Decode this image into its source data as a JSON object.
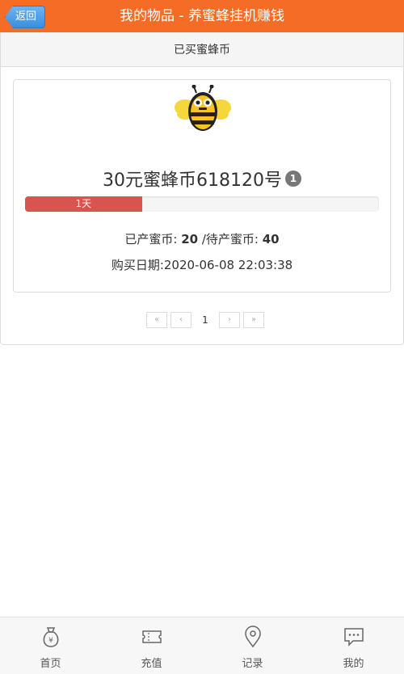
{
  "header": {
    "back_label": "返回",
    "title": "我的物品 - 养蜜蜂挂机赚钱"
  },
  "panel": {
    "heading": "已买蜜蜂币"
  },
  "item": {
    "name": "30元蜜蜂币618120号",
    "badge": "1",
    "progress": {
      "label": "1天",
      "percent": 33
    },
    "produced_label": "已产蜜币: ",
    "produced_value": "20",
    "pending_label": " /待产蜜币: ",
    "pending_value": "40",
    "buy_date": "购买日期:2020-06-08 22:03:38"
  },
  "pagination": {
    "first": "«",
    "prev": "‹",
    "current": "1",
    "next": "›",
    "last": "»"
  },
  "tabbar": {
    "items": [
      {
        "label": "首页",
        "icon": "money-bag-icon"
      },
      {
        "label": "充值",
        "icon": "ticket-icon"
      },
      {
        "label": "记录",
        "icon": "location-pin-icon"
      },
      {
        "label": "我的",
        "icon": "chat-bubble-icon"
      }
    ]
  },
  "colors": {
    "header_bg": "#f46c25",
    "progress_fill": "#d9534f",
    "back_button": "#3a8fe0"
  }
}
